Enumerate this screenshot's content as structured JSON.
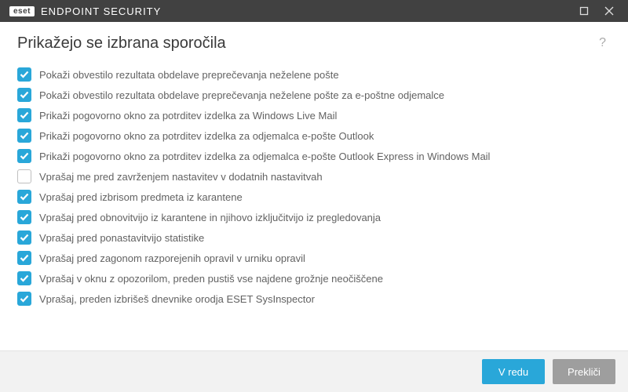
{
  "titlebar": {
    "brand_badge": "eset",
    "brand_name": "ENDPOINT SECURITY"
  },
  "header": {
    "title": "Prikažejo se izbrana sporočila"
  },
  "items": [
    {
      "checked": true,
      "label": "Pokaži obvestilo rezultata obdelave preprečevanja neželene pošte"
    },
    {
      "checked": true,
      "label": "Pokaži obvestilo rezultata obdelave preprečevanja neželene pošte za e-poštne odjemalce"
    },
    {
      "checked": true,
      "label": "Prikaži pogovorno okno za potrditev izdelka za Windows Live Mail"
    },
    {
      "checked": true,
      "label": "Prikaži pogovorno okno za potrditev izdelka za odjemalca e-pošte Outlook"
    },
    {
      "checked": true,
      "label": "Prikaži pogovorno okno za potrditev izdelka za odjemalca e-pošte Outlook Express in Windows Mail"
    },
    {
      "checked": false,
      "label": "Vprašaj me pred zavrženjem nastavitev v dodatnih nastavitvah"
    },
    {
      "checked": true,
      "label": "Vprašaj pred izbrisom predmeta iz karantene"
    },
    {
      "checked": true,
      "label": "Vprašaj pred obnovitvijo iz karantene in njihovo izključitvijo iz pregledovanja"
    },
    {
      "checked": true,
      "label": "Vprašaj pred ponastavitvijo statistike"
    },
    {
      "checked": true,
      "label": "Vprašaj pred zagonom razporejenih opravil v urniku opravil"
    },
    {
      "checked": true,
      "label": "Vprašaj v oknu z opozorilom, preden pustiš vse najdene grožnje neočiščene"
    },
    {
      "checked": true,
      "label": "Vprašaj, preden izbrišeš dnevnike orodja ESET SysInspector"
    }
  ],
  "footer": {
    "ok": "V redu",
    "cancel": "Prekliči"
  },
  "colors": {
    "accent": "#29a7d9",
    "titlebar": "#414141",
    "footer_bg": "#f2f2f2"
  }
}
